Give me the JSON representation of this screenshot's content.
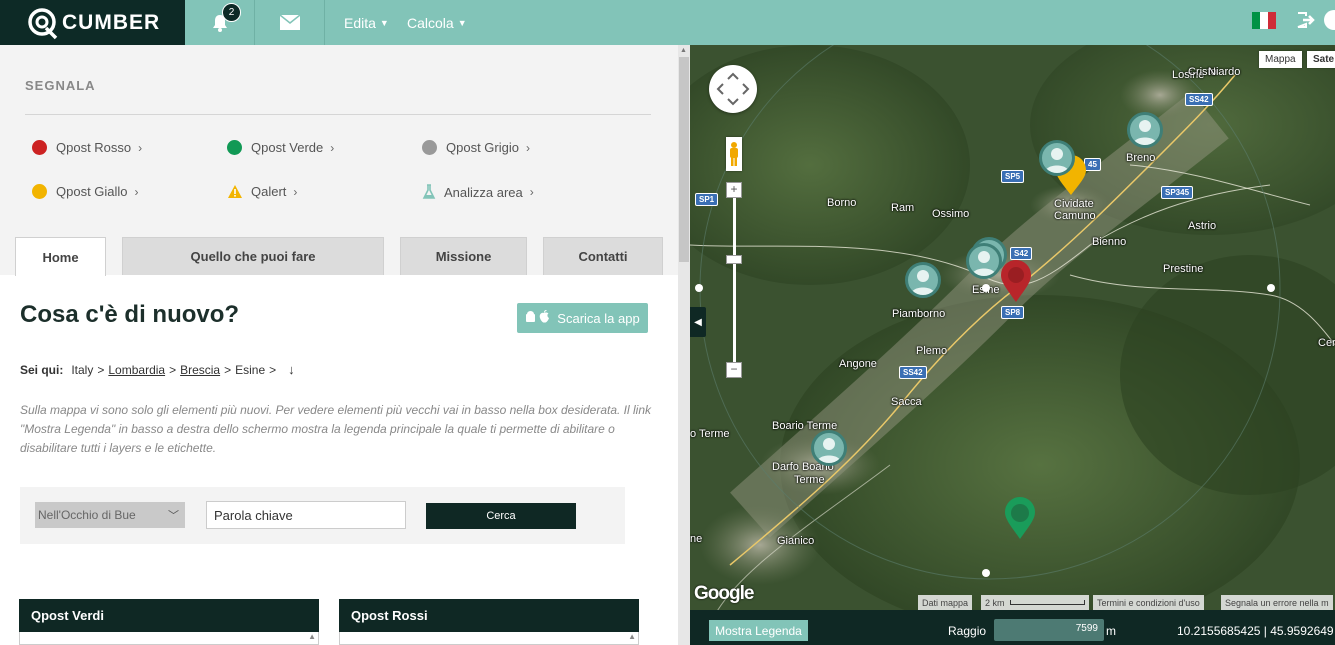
{
  "header": {
    "logo_text": "CUMBER",
    "notifications_count": "2",
    "menu": [
      {
        "label": "Edita"
      },
      {
        "label": "Calcola"
      }
    ],
    "flag_colors": [
      "#009246",
      "#ffffff",
      "#ce2b37"
    ]
  },
  "segnala": {
    "title": "SEGNALA",
    "items": [
      {
        "label": "Qpost Rosso",
        "color": "#cc2222"
      },
      {
        "label": "Qpost Verde",
        "color": "#119955"
      },
      {
        "label": "Qpost Grigio",
        "color": "#999999"
      },
      {
        "label": "Qpost Giallo",
        "color": "#f2b400"
      },
      {
        "label": "Qalert",
        "icon": "warning-icon",
        "color": "#f2b400"
      },
      {
        "label": "Analizza area",
        "icon": "flask-icon",
        "color": "#82c4b8"
      }
    ]
  },
  "tabs": [
    {
      "label": "Home",
      "active": true
    },
    {
      "label": "Quello che puoi fare",
      "active": false
    },
    {
      "label": "Missione",
      "active": false
    },
    {
      "label": "Contatti",
      "active": false
    }
  ],
  "main": {
    "title": "Cosa c'è di nuovo?",
    "app_button": "Scarica la app",
    "breadcrumb": {
      "label": "Sei qui:",
      "items": [
        "Italy",
        "Lombardia",
        "Brescia",
        "Esine"
      ]
    },
    "intro": "Sulla mappa vi sono solo gli elementi più nuovi. Per vedere elementi più vecchi vai in basso nella box desiderata. Il link \"Mostra Legenda\" in basso a destra dello schermo mostra la legenda principale la quale ti permette di abilitare o disabilitare tutti i layers e le etichette."
  },
  "search": {
    "select_value": "Nell'Occhio di Bue",
    "keyword_placeholder": "Parola chiave",
    "button": "Cerca"
  },
  "boxes": [
    {
      "title": "Qpost Verdi"
    },
    {
      "title": "Qpost Rossi"
    }
  ],
  "map": {
    "type_buttons": [
      "Mappa",
      "Sate"
    ],
    "places": [
      {
        "name": "Losine"
      },
      {
        "name": "Cristo"
      },
      {
        "name": "Niardo"
      },
      {
        "name": "Breno"
      },
      {
        "name": "Cividate"
      },
      {
        "name": "Camuno"
      },
      {
        "name": "Borno"
      },
      {
        "name": "Ram"
      },
      {
        "name": "Ossimo"
      },
      {
        "name": "Astrio"
      },
      {
        "name": "Bienno"
      },
      {
        "name": "Prestine"
      },
      {
        "name": "Esine"
      },
      {
        "name": "Piamborno"
      },
      {
        "name": "Plemo"
      },
      {
        "name": "Angone"
      },
      {
        "name": "Sacca"
      },
      {
        "name": "Boario Terme"
      },
      {
        "name": "Darfo Boario"
      },
      {
        "name": "Terme"
      },
      {
        "name": "o Terme"
      },
      {
        "name": "Gianico"
      },
      {
        "name": "Cer"
      },
      {
        "name": "ne"
      }
    ],
    "roads": [
      "SS42",
      "SP5",
      "SP345",
      "S42",
      "SP8",
      "SS42",
      "SP1",
      "45"
    ],
    "attribution": {
      "data": "Dati mappa",
      "scale": "2 km",
      "terms": "Termini e condizioni d'uso",
      "report": "Segnala un errore nella m"
    },
    "google": "Google"
  },
  "footer": {
    "legend_button": "Mostra Legenda",
    "raggio_label": "Raggio",
    "raggio_value": "7599",
    "raggio_unit": "m",
    "coords": "10.2155685425 | 45.9592649"
  },
  "colors": {
    "brand_dark": "#0f2824",
    "brand_light": "#82c4b8"
  }
}
